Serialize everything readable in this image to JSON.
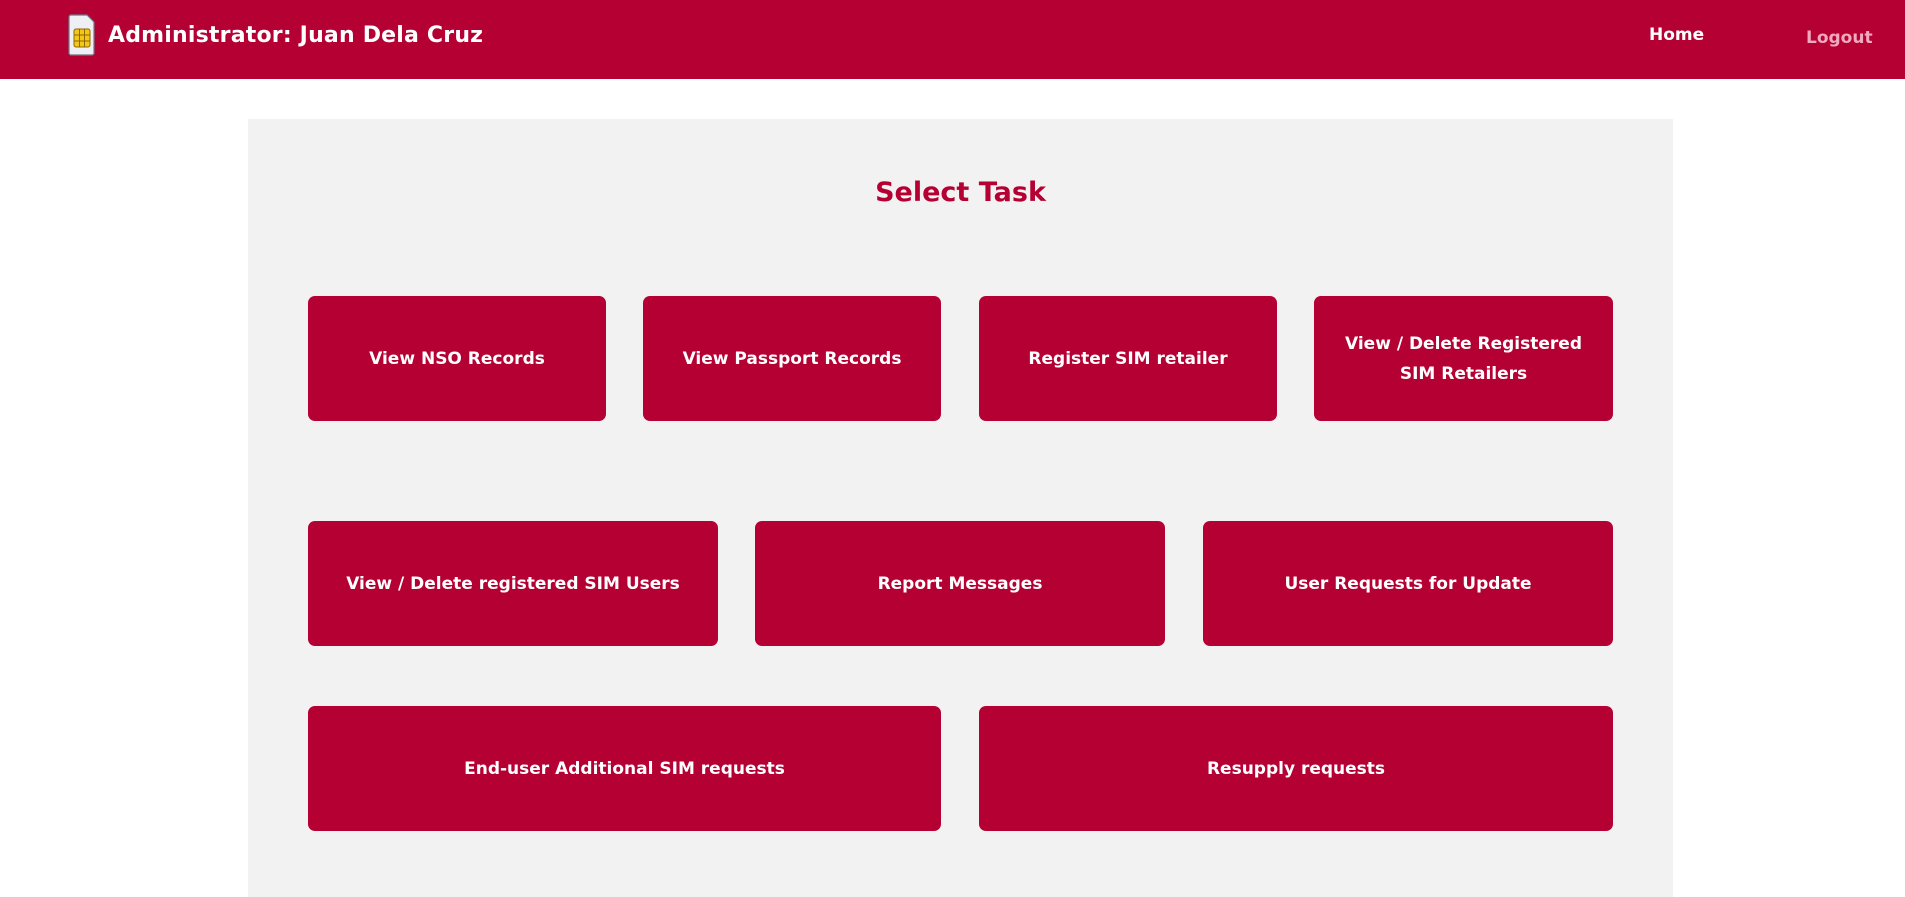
{
  "header": {
    "title": "Administrator: Juan Dela Cruz",
    "icon": "sim-card-icon",
    "nav": {
      "home_label": "Home",
      "logout_label": "Logout"
    }
  },
  "main": {
    "title": "Select Task",
    "tasks": [
      {
        "label": "View NSO Records"
      },
      {
        "label": "View Passport Records"
      },
      {
        "label": "Register SIM retailer"
      },
      {
        "label": "View / Delete Registered SIM Retailers"
      },
      {
        "label": "View / Delete registered SIM Users"
      },
      {
        "label": "Report Messages"
      },
      {
        "label": "User Requests for Update"
      },
      {
        "label": "End-user Additional SIM requests"
      },
      {
        "label": "Resupply requests"
      }
    ]
  },
  "colors": {
    "brand": "#b50033",
    "panel_background": "#f2f2f2",
    "logout_text": "#f2a8bd"
  }
}
